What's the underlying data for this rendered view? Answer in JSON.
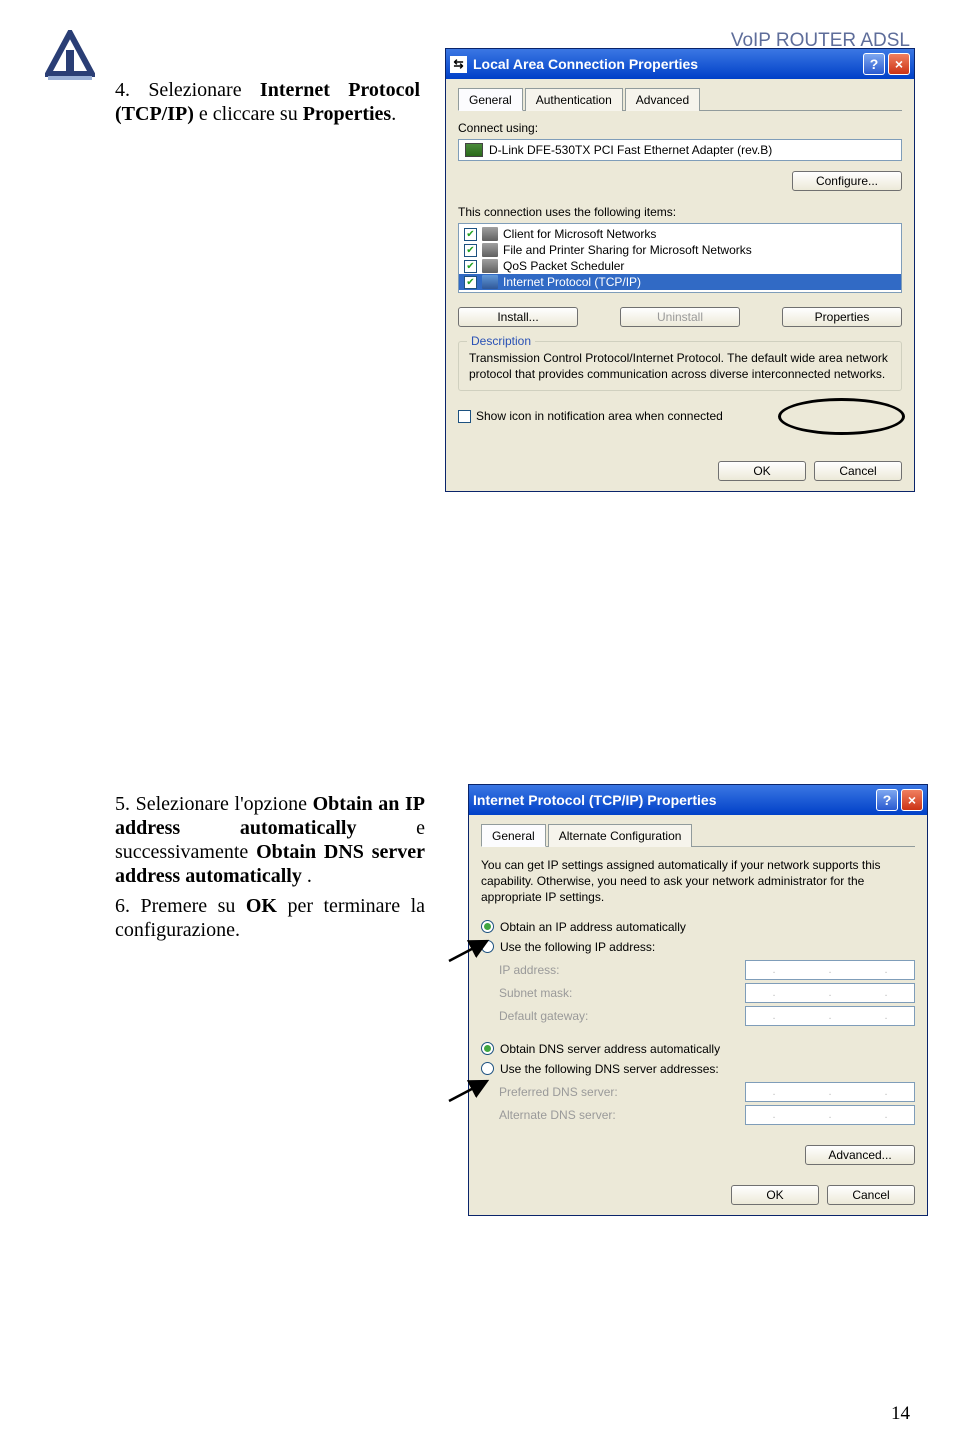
{
  "header": {
    "title": "VoIP ROUTER ADSL"
  },
  "instructions": {
    "step4_num": "4.",
    "step4_a": "Selezionare ",
    "step4_b": "Internet Protocol (TCP/IP)",
    "step4_c": " e cliccare su ",
    "step4_d": "Properties",
    "step4_e": ".",
    "step5_num": "5.",
    "step5_a": "Selezionare l'opzione ",
    "step5_b": "Obtain an IP address automatically",
    "step5_c": " e successivamente ",
    "step5_d": "Obtain DNS server address automatically",
    "step5_e": " .",
    "step6_num": "6.",
    "step6_a": "Premere su ",
    "step6_b": "OK",
    "step6_c": " per terminare la configurazione."
  },
  "dialog1": {
    "title": "Local Area Connection Properties",
    "tabs": {
      "general": "General",
      "auth": "Authentication",
      "adv": "Advanced"
    },
    "connect_using": "Connect using:",
    "adapter": "D-Link DFE-530TX PCI Fast Ethernet Adapter (rev.B)",
    "configure": "Configure...",
    "uses_items": "This connection uses the following items:",
    "items": {
      "i0": "Client for Microsoft Networks",
      "i1": "File and Printer Sharing for Microsoft Networks",
      "i2": "QoS Packet Scheduler",
      "i3": "Internet Protocol (TCP/IP)"
    },
    "install": "Install...",
    "uninstall": "Uninstall",
    "properties": "Properties",
    "desc_label": "Description",
    "desc_text": "Transmission Control Protocol/Internet Protocol. The default wide area network protocol that provides communication across diverse interconnected networks.",
    "show_icon": "Show icon in notification area when connected",
    "ok": "OK",
    "cancel": "Cancel"
  },
  "dialog2": {
    "title": "Internet Protocol (TCP/IP) Properties",
    "tabs": {
      "general": "General",
      "alt": "Alternate Configuration"
    },
    "intro": "You can get IP settings assigned automatically if your network supports this capability. Otherwise, you need to ask your network administrator for the appropriate IP settings.",
    "r_auto_ip": "Obtain an IP address automatically",
    "r_use_ip": "Use the following IP address:",
    "ip_addr": "IP address:",
    "subnet": "Subnet mask:",
    "gateway": "Default gateway:",
    "r_auto_dns": "Obtain DNS server address automatically",
    "r_use_dns": "Use the following DNS server addresses:",
    "pref_dns": "Preferred DNS server:",
    "alt_dns": "Alternate DNS server:",
    "advanced": "Advanced...",
    "ok": "OK",
    "cancel": "Cancel"
  },
  "page_number": "14"
}
